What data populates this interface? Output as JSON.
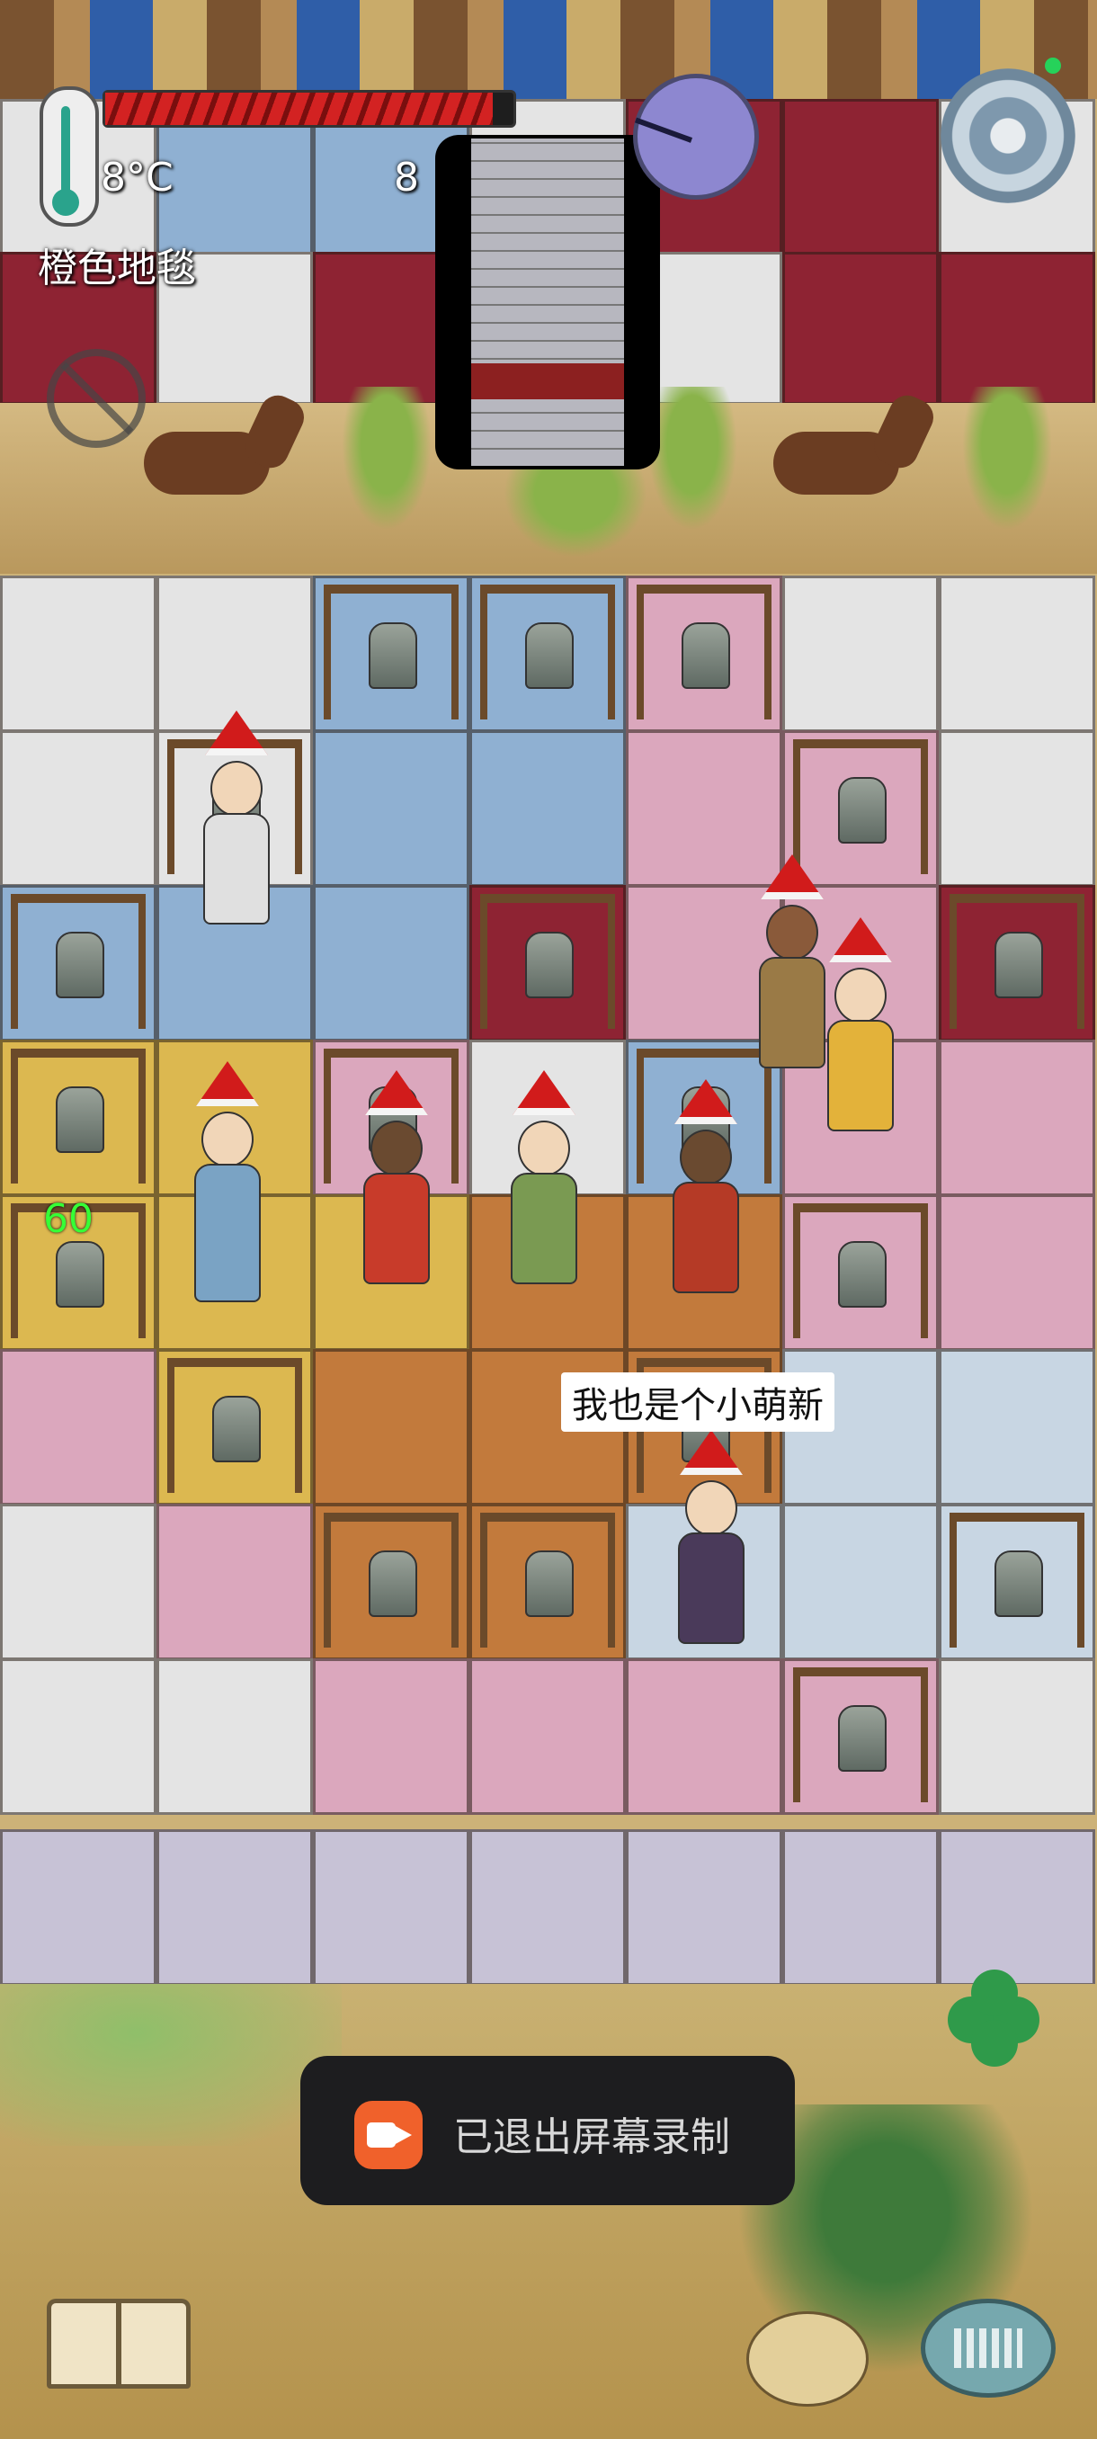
{
  "hud": {
    "temperature": "8°C",
    "counter": "8",
    "location": "橙色地毯",
    "health_fraction": 0.95,
    "float_number": "60"
  },
  "npc_speech": "我也是个小萌新",
  "toast": {
    "message": "已退出屏幕录制",
    "icon": "screen-record-icon"
  },
  "colors": {
    "blue": "#8fb0d2",
    "red": "#8e2333",
    "pink": "#dba7bd",
    "yellow": "#dcb850",
    "orange": "#c27a3c",
    "white": "#e4e4e4",
    "pale_blue": "#c8d6e3",
    "lavender": "#c7c2d6"
  },
  "icons": [
    "thermometer-icon",
    "settings-gear-icon",
    "clock-icon",
    "no-sign-icon",
    "book-icon",
    "keyboard-icon",
    "clover-icon"
  ]
}
